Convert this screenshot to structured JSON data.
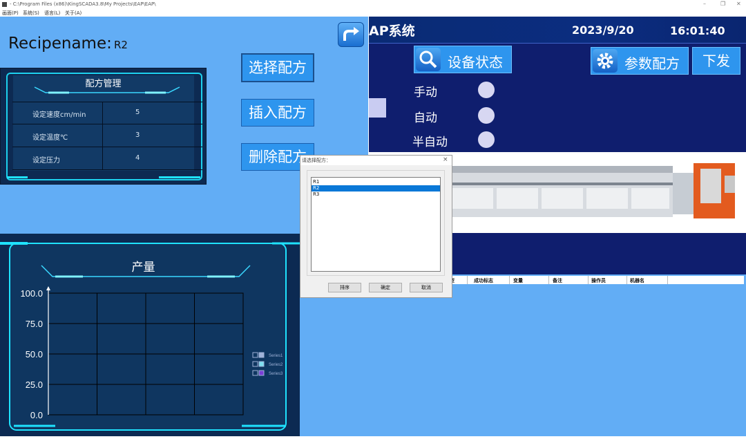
{
  "window": {
    "title": "- C:\\Program Files (x86)\\KingSCADA3.8\\My Projects\\EAP\\EAP\\",
    "minimize": "–",
    "maximize": "❐",
    "close": "✕"
  },
  "menu": [
    "画面(P)",
    "系统(S)",
    "语言(L)",
    "关于(A)"
  ],
  "recipe": {
    "label": "Recipename:",
    "value": "R2",
    "card_title": "配方管理",
    "rows": [
      {
        "name": "设定速度cm/min",
        "value": "5"
      },
      {
        "name": "设定温度℃",
        "value": "3"
      },
      {
        "name": "设定压力",
        "value": "4"
      }
    ]
  },
  "buttons": {
    "select": "选择配方",
    "insert": "插入配方",
    "delete": "删除配方"
  },
  "header": {
    "system_title": "AP系统",
    "date": "2023/9/20",
    "time": "16:01:40",
    "device_status": "设备状态",
    "param_recipe": "参数配方",
    "dispatch": "下发"
  },
  "modes": [
    "手动",
    "自动",
    "半自动"
  ],
  "chart_data": {
    "type": "line",
    "title": "产量",
    "ylim": [
      0,
      100
    ],
    "yticks": [
      "100.0",
      "75.0",
      "50.0",
      "25.0",
      "0.0"
    ],
    "series": [
      {
        "name": "Series1",
        "values": []
      },
      {
        "name": "Series2",
        "values": []
      },
      {
        "name": "Series3",
        "values": []
      }
    ],
    "series_colors": [
      "#9fb3d9",
      "#7ee0f0",
      "#7a3fd6"
    ],
    "grid": true,
    "legend": "right"
  },
  "table": {
    "headers": [
      "型",
      "成功标志",
      "变量",
      "备注",
      "操作员",
      "机器名"
    ]
  },
  "dialog": {
    "title": "请选择配方：",
    "close": "×",
    "items": [
      "R1",
      "R2",
      "R3"
    ],
    "selected_index": 1,
    "buttons": [
      "排序",
      "确定",
      "取消"
    ]
  },
  "colors": {
    "panel_blue": "#62adf5",
    "button_blue": "#2e95ee",
    "navy": "#0f1e6e",
    "glow": "#1fe3ff",
    "selection": "#0a78d7"
  }
}
